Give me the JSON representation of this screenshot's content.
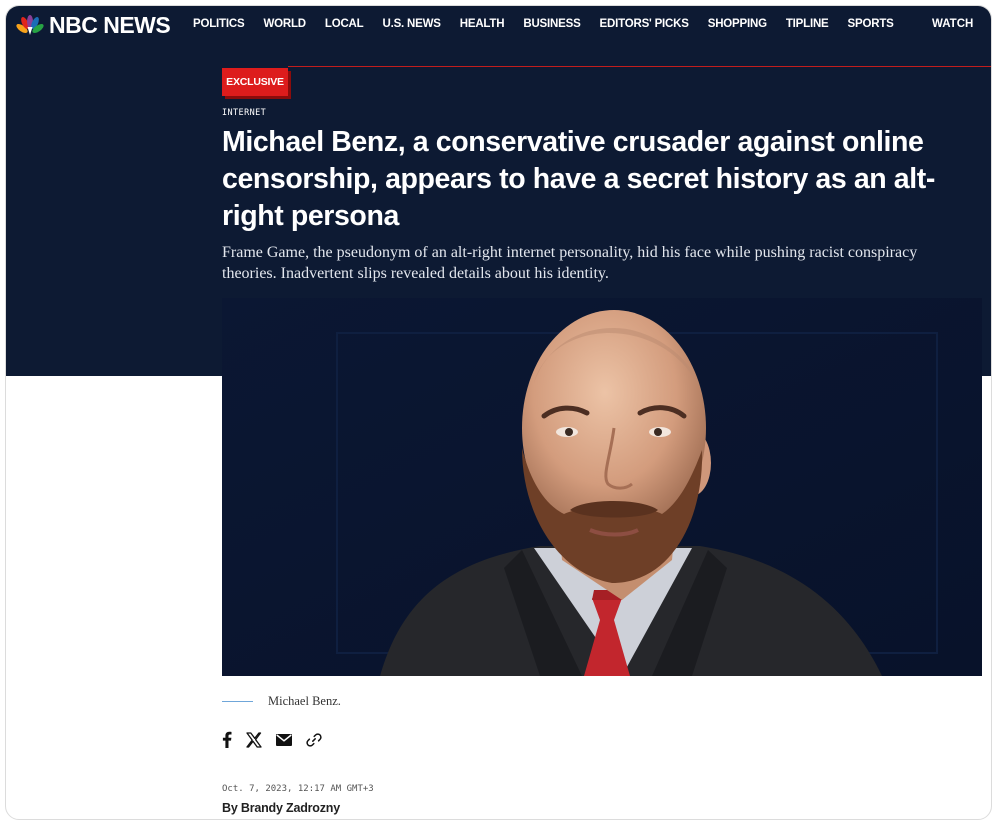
{
  "brand": {
    "name": "NBC NEWS"
  },
  "nav": {
    "items": [
      "POLITICS",
      "WORLD",
      "LOCAL",
      "U.S. NEWS",
      "HEALTH",
      "BUSINESS",
      "EDITORS' PICKS",
      "SHOPPING",
      "TIPLINE",
      "SPORTS"
    ],
    "watch_label": "WATCH"
  },
  "article": {
    "badge": "EXCLUSIVE",
    "category": "INTERNET",
    "headline": "Michael Benz, a conservative crusader against online censorship, appears to have a secret history as an alt-right persona",
    "dek": "Frame Game, the pseudonym of an alt-right internet personality, hid his face while pushing racist conspiracy theories. Inadvertent slips revealed details about his identity.",
    "caption": "Michael Benz.",
    "date": "Oct. 7, 2023, 12:17 AM GMT+3",
    "byline_prefix": "By",
    "author": "Brandy Zadrozny"
  },
  "share": {
    "icons": [
      "facebook-icon",
      "x-twitter-icon",
      "email-icon",
      "link-icon"
    ]
  },
  "colors": {
    "header_bg": "#0d1a33",
    "badge_red": "#dd1c1c",
    "badge_shadow": "#8b0c0c",
    "caption_line": "#6fa6d9"
  }
}
